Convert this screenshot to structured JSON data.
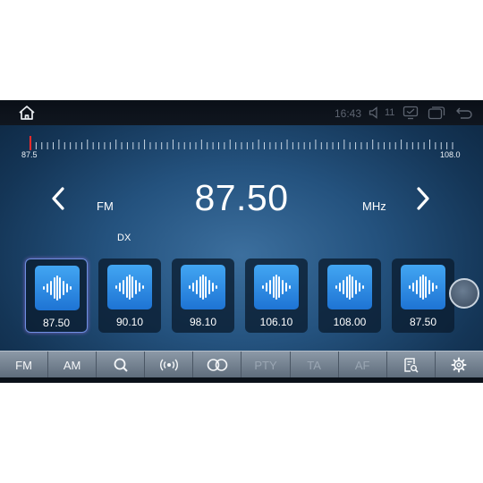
{
  "status_bar": {
    "time": "16:43",
    "volume_level": "11",
    "icons": [
      "home-icon",
      "volume-icon",
      "screen-icon",
      "recent-apps-icon",
      "back-icon"
    ]
  },
  "tuner": {
    "scale_min": "87.5",
    "scale_max": "108.0",
    "needle_position": 0,
    "band": "FM",
    "frequency": "87.50",
    "unit": "MHz",
    "dx_label": "DX"
  },
  "presets": [
    {
      "freq": "87.50",
      "active": true
    },
    {
      "freq": "90.10",
      "active": false
    },
    {
      "freq": "98.10",
      "active": false
    },
    {
      "freq": "106.10",
      "active": false
    },
    {
      "freq": "108.00",
      "active": false
    },
    {
      "freq": "87.50",
      "active": false
    }
  ],
  "toolbar": {
    "fm": "FM",
    "am": "AM",
    "pty": "PTY",
    "ta": "TA",
    "af": "AF",
    "icons": [
      "search-icon",
      "broadcast-icon",
      "stereo-icon",
      "scan-list-icon",
      "settings-icon"
    ]
  },
  "colors": {
    "background": "#1e4a74",
    "preset_icon": "#2b8ce6",
    "needle": "#ff2a2a",
    "active_border": "#6d8fe0"
  }
}
